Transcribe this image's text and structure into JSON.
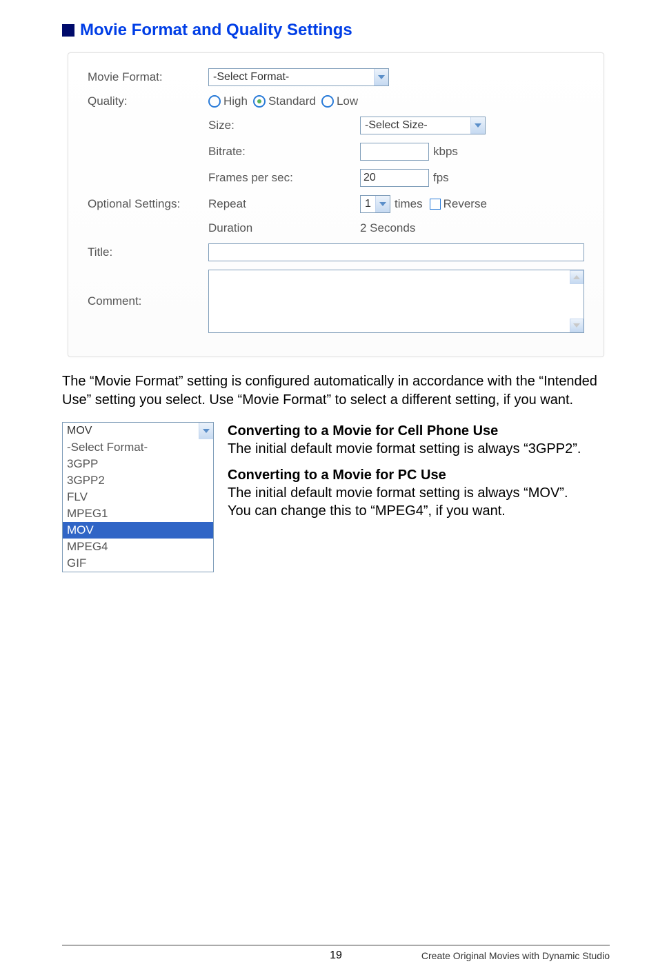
{
  "heading": "Movie Format and Quality Settings",
  "panel": {
    "movieFormatLabel": "Movie Format:",
    "movieFormatValue": "-Select Format-",
    "qualityLabel": "Quality:",
    "qualityOptions": {
      "high": "High",
      "standard": "Standard",
      "low": "Low"
    },
    "sizeLabel": "Size:",
    "sizeValue": "-Select Size-",
    "bitrateLabel": "Bitrate:",
    "bitrateUnit": "kbps",
    "fpsLabel": "Frames per sec:",
    "fpsValue": "20",
    "fpsUnit": "fps",
    "optionalLabel": "Optional Settings:",
    "repeatLabel": "Repeat",
    "repeatValue": "1",
    "timesLabel": "times",
    "reverseLabel": "Reverse",
    "durationLabel": "Duration",
    "durationValue": "2 Seconds",
    "titleLabel": "Title:",
    "commentLabel": "Comment:"
  },
  "paragraph": "The “Movie Format” setting is configured automatically in accordance with the “Intended Use” setting you select. Use “Movie Format” to select a different setting, if you want.",
  "dropdown": {
    "currentValue": "MOV",
    "items": [
      "-Select Format-",
      "3GPP",
      "3GPP2",
      "FLV",
      "MPEG1",
      "MOV",
      "MPEG4",
      "GIF"
    ],
    "selected": "MOV"
  },
  "section1": {
    "title": "Converting to a Movie for Cell Phone Use",
    "body": "The initial default movie format setting is always “3GPP2”."
  },
  "section2": {
    "title": "Converting to a Movie for PC Use",
    "body1": "The initial default movie format setting is always “MOV”.",
    "body2": "You can change this to “MPEG4”, if you want."
  },
  "footer": {
    "pageNumber": "19",
    "rightText": "Create Original Movies with Dynamic Studio"
  }
}
